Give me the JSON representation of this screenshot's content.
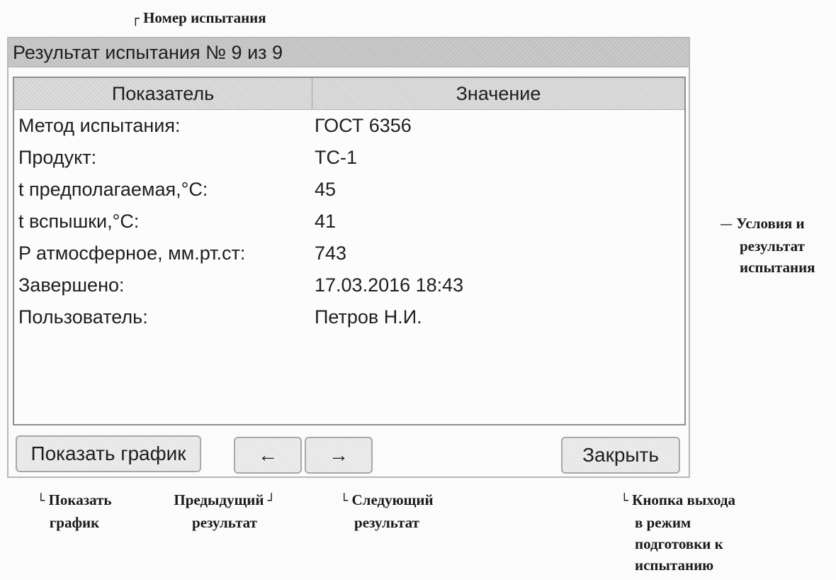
{
  "annotations": {
    "test_number": "Номер испытания",
    "conditions_line1": "Условия и",
    "conditions_line2": "результат",
    "conditions_line3": "испытания",
    "show_chart_line1": "Показать",
    "show_chart_line2": "график",
    "prev_line1": "Предыдущий",
    "prev_line2": "результат",
    "next_line1": "Следующий",
    "next_line2": "результат",
    "exit_line1": "Кнопка выхода",
    "exit_line2": "в режим",
    "exit_line3": "подготовки к",
    "exit_line4": "испытанию"
  },
  "window": {
    "title": "Результат испытания № 9 из 9"
  },
  "table": {
    "headers": [
      "Показатель",
      "Значение"
    ],
    "rows": [
      {
        "label": "Метод испытания:",
        "value": "ГОСТ 6356"
      },
      {
        "label": "Продукт:",
        "value": "ТС-1"
      },
      {
        "label": "t предполагаемая,°C:",
        "value": "45"
      },
      {
        "label": "t вспышки,°C:",
        "value": "41"
      },
      {
        "label": "P атмосферное, мм.рт.ст:",
        "value": "743"
      },
      {
        "label": "Завершено:",
        "value": "17.03.2016 18:43"
      },
      {
        "label": "Пользователь:",
        "value": "Петров Н.И."
      }
    ]
  },
  "buttons": {
    "show_chart": "Показать график",
    "prev": "←",
    "next": "→",
    "close": "Закрыть"
  }
}
